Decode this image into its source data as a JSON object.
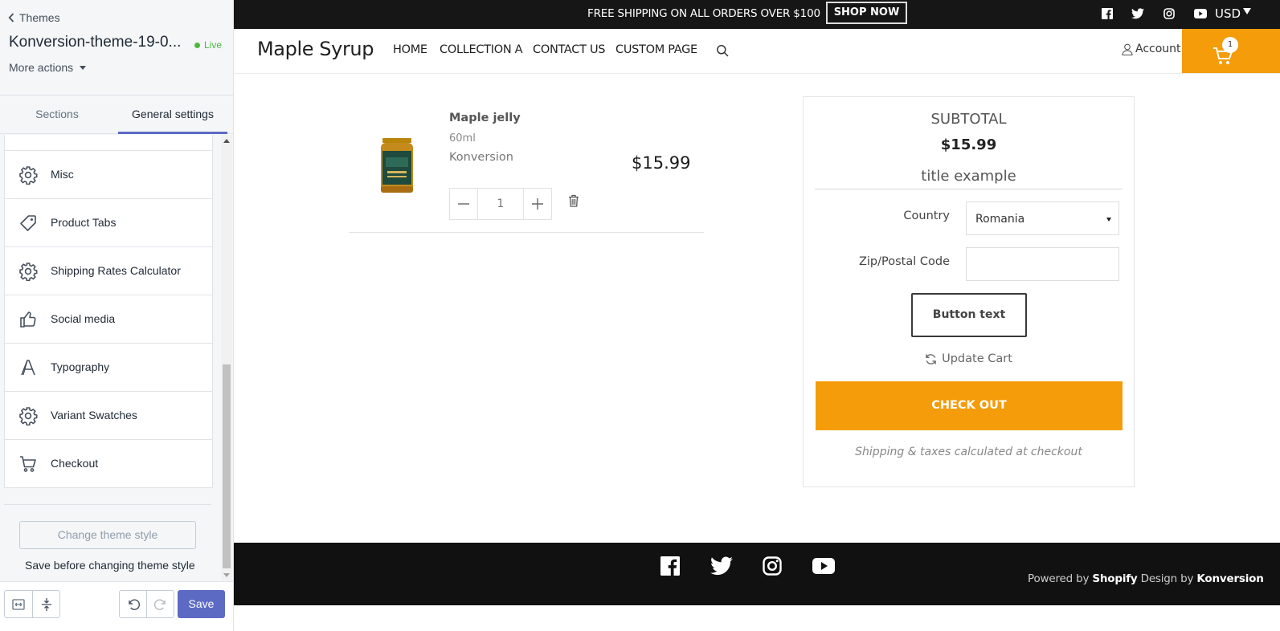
{
  "editor": {
    "back_label": "Themes",
    "theme_name": "Konversion-theme-19-0...",
    "live_label": "Live",
    "more_actions": "More actions",
    "tabs": [
      {
        "label": "Sections"
      },
      {
        "label": "General settings"
      }
    ],
    "active_tab": "General settings",
    "settings_items": [
      {
        "label": "Misc",
        "icon": "gear-icon"
      },
      {
        "label": "Product Tabs",
        "icon": "tag-icon"
      },
      {
        "label": "Shipping Rates Calculator",
        "icon": "gear-icon"
      },
      {
        "label": "Social media",
        "icon": "thumbs-up-icon"
      },
      {
        "label": "Typography",
        "icon": "typography-icon"
      },
      {
        "label": "Variant Swatches",
        "icon": "gear-icon"
      },
      {
        "label": "Checkout",
        "icon": "cart-icon"
      }
    ],
    "change_style_button": "Change theme style",
    "save_note": "Save before changing theme style",
    "save_button": "Save",
    "accent_color": "#5c6ac4"
  },
  "store": {
    "announcement": "FREE SHIPPING ON ALL ORDERS OVER $100",
    "shop_now": "SHOP NOW",
    "currency": "USD",
    "logo": "Maple Syrup",
    "nav": [
      {
        "label": "HOME"
      },
      {
        "label": "COLLECTION A"
      },
      {
        "label": "CONTACT US"
      },
      {
        "label": "CUSTOM PAGE"
      }
    ],
    "account_label": "Account",
    "cart_count": "1",
    "accent_color": "#f49c09"
  },
  "cart": {
    "item": {
      "title": "Maple jelly",
      "variant": "60ml",
      "vendor": "Konversion",
      "price": "$15.99",
      "quantity": "1"
    },
    "subtotal_label": "SUBTOTAL",
    "subtotal_value": "$15.99",
    "title_example": "title example",
    "country_label": "Country",
    "country_value": "Romania",
    "zip_label": "Zip/Postal Code",
    "zip_value": "",
    "button_text": "Button text",
    "update_cart": "Update Cart",
    "checkout": "CHECK OUT",
    "shipping_note": "Shipping & taxes calculated at checkout"
  },
  "footer": {
    "powered_prefix": "Powered by",
    "shopify": "Shopify",
    "design_by": "Design by",
    "konversion": "Konversion"
  }
}
